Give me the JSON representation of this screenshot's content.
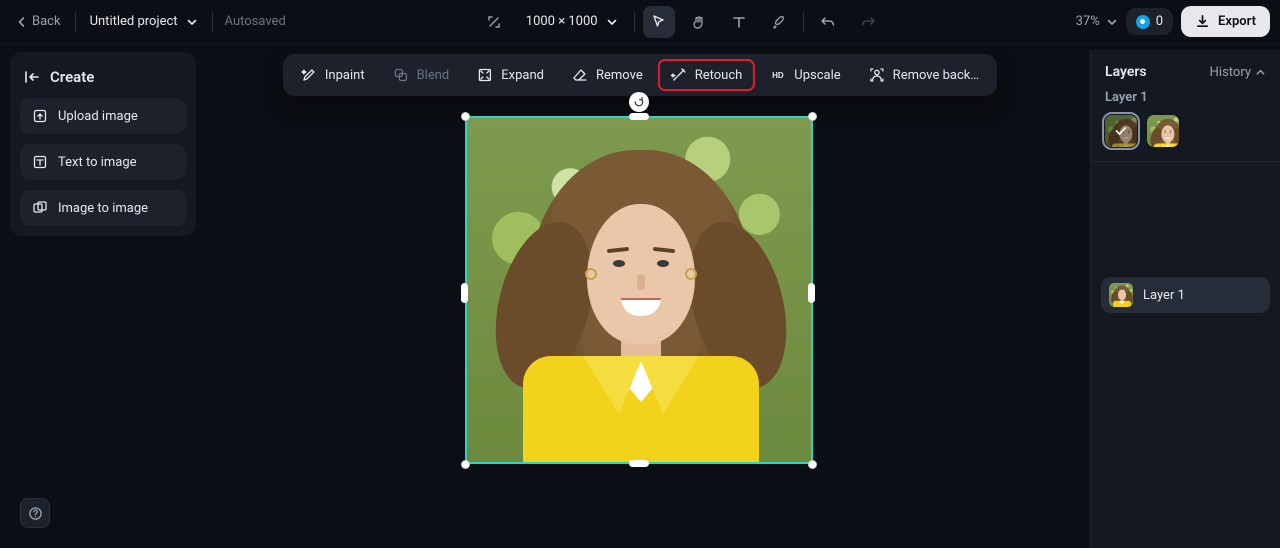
{
  "topbar": {
    "back": "Back",
    "project_name": "Untitled project",
    "autosaved": "Autosaved",
    "dimensions": "1000 × 1000",
    "zoom": "37%",
    "credits": "0",
    "export": "Export"
  },
  "tools": {
    "actions": [
      {
        "key": "inpaint",
        "label": "Inpaint",
        "icon": "pen-sparkle-icon",
        "disabled": false,
        "highlighted": false
      },
      {
        "key": "blend",
        "label": "Blend",
        "icon": "blend-icon",
        "disabled": true,
        "highlighted": false
      },
      {
        "key": "expand",
        "label": "Expand",
        "icon": "expand-icon",
        "disabled": false,
        "highlighted": false
      },
      {
        "key": "remove",
        "label": "Remove",
        "icon": "eraser-icon",
        "disabled": false,
        "highlighted": false
      },
      {
        "key": "retouch",
        "label": "Retouch",
        "icon": "wand-icon",
        "disabled": false,
        "highlighted": true
      },
      {
        "key": "upscale",
        "label": "Upscale",
        "icon": "hd-icon",
        "disabled": false,
        "highlighted": false
      },
      {
        "key": "remove_bg",
        "label": "Remove back…",
        "icon": "person-cut-icon",
        "disabled": false,
        "highlighted": false
      }
    ]
  },
  "sidebar": {
    "create_label": "Create",
    "options": [
      {
        "key": "upload",
        "label": "Upload image",
        "icon": "upload-icon"
      },
      {
        "key": "t2i",
        "label": "Text to image",
        "icon": "text-to-image-icon"
      },
      {
        "key": "i2i",
        "label": "Image to image",
        "icon": "image-to-image-icon"
      }
    ]
  },
  "layers_panel": {
    "title": "Layers",
    "history": "History",
    "current_layer": "Layer 1",
    "layer_row_label": "Layer 1"
  }
}
